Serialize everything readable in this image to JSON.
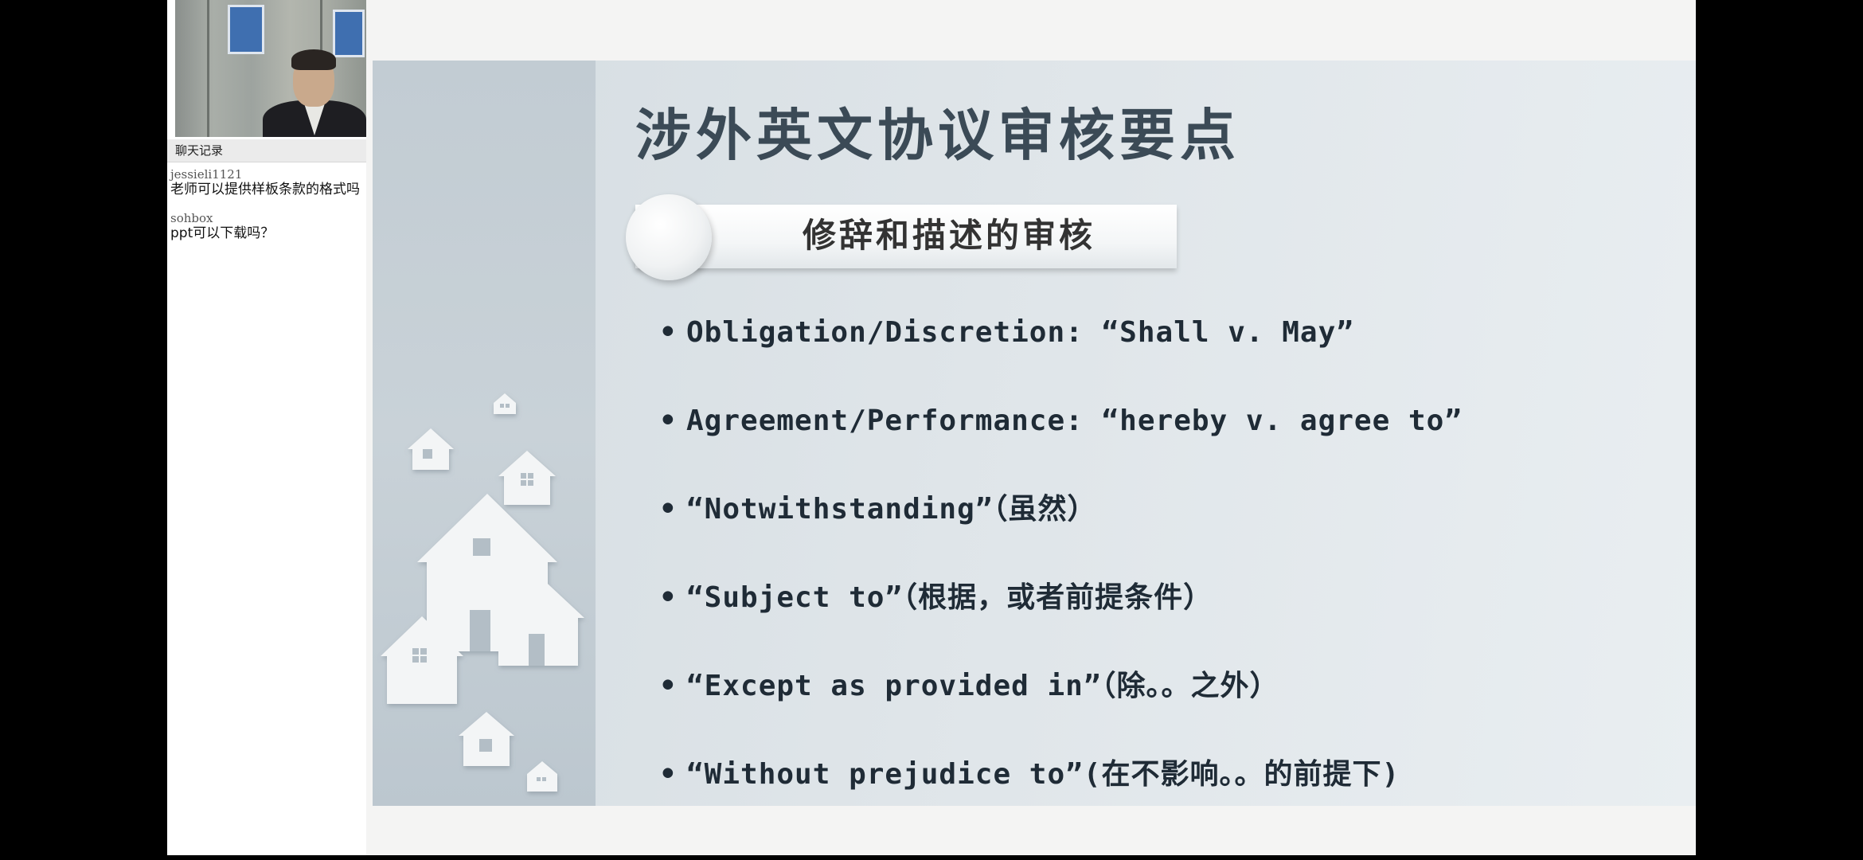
{
  "chat": {
    "header": "聊天记录",
    "messages": [
      {
        "user": "jessieli1121",
        "text": "老师可以提供样板条款的格式吗"
      },
      {
        "user": "sohbox",
        "text": "ppt可以下载吗？"
      }
    ]
  },
  "slide": {
    "title": "涉外英文协议审核要点",
    "banner": "修辞和描述的审核",
    "bullet_marker": "•",
    "bullets": [
      "Obligation/Discretion: “Shall v. May”",
      "Agreement/Performance: “hereby v. agree to”",
      "“Notwithstanding”（虽然）",
      "“Subject to”（根据，或者前提条件）",
      "“Except as provided in”（除。。之外）",
      "“Without prejudice to”(在不影响。。的前提下)"
    ]
  },
  "icons": {
    "decoration": "houses-illustration",
    "video": "presenter-video"
  }
}
